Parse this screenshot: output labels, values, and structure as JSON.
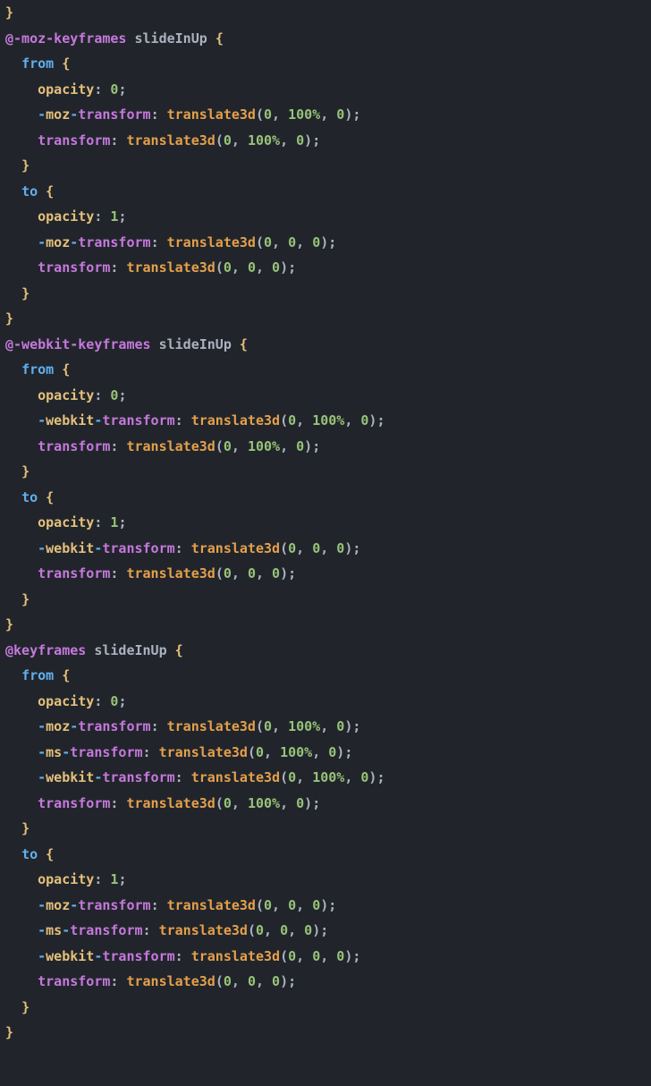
{
  "code": {
    "lines": [
      "}",
      "@-moz-keyframes slideInUp {",
      "  from {",
      "    opacity: 0;",
      "    -moz-transform: translate3d(0, 100%, 0);",
      "    transform: translate3d(0, 100%, 0);",
      "  }",
      "  to {",
      "    opacity: 1;",
      "    -moz-transform: translate3d(0, 0, 0);",
      "    transform: translate3d(0, 0, 0);",
      "  }",
      "}",
      "@-webkit-keyframes slideInUp {",
      "  from {",
      "    opacity: 0;",
      "    -webkit-transform: translate3d(0, 100%, 0);",
      "    transform: translate3d(0, 100%, 0);",
      "  }",
      "  to {",
      "    opacity: 1;",
      "    -webkit-transform: translate3d(0, 0, 0);",
      "    transform: translate3d(0, 0, 0);",
      "  }",
      "}",
      "@keyframes slideInUp {",
      "  from {",
      "    opacity: 0;",
      "    -moz-transform: translate3d(0, 100%, 0);",
      "    -ms-transform: translate3d(0, 100%, 0);",
      "    -webkit-transform: translate3d(0, 100%, 0);",
      "    transform: translate3d(0, 100%, 0);",
      "  }",
      "  to {",
      "    opacity: 1;",
      "    -moz-transform: translate3d(0, 0, 0);",
      "    -ms-transform: translate3d(0, 0, 0);",
      "    -webkit-transform: translate3d(0, 0, 0);",
      "    transform: translate3d(0, 0, 0);",
      "  }",
      "}"
    ]
  },
  "colors": {
    "at_rule": "#c678dd",
    "keyword_fromto": "#61afef",
    "brace": "#e5c07b",
    "property": "#e5c07b",
    "transform_kw": "#c678dd",
    "funcname": "#e5a04b",
    "number": "#98c379",
    "vendor_dash": "#61afef",
    "default": "#abb2bf",
    "background": "#21252b"
  }
}
